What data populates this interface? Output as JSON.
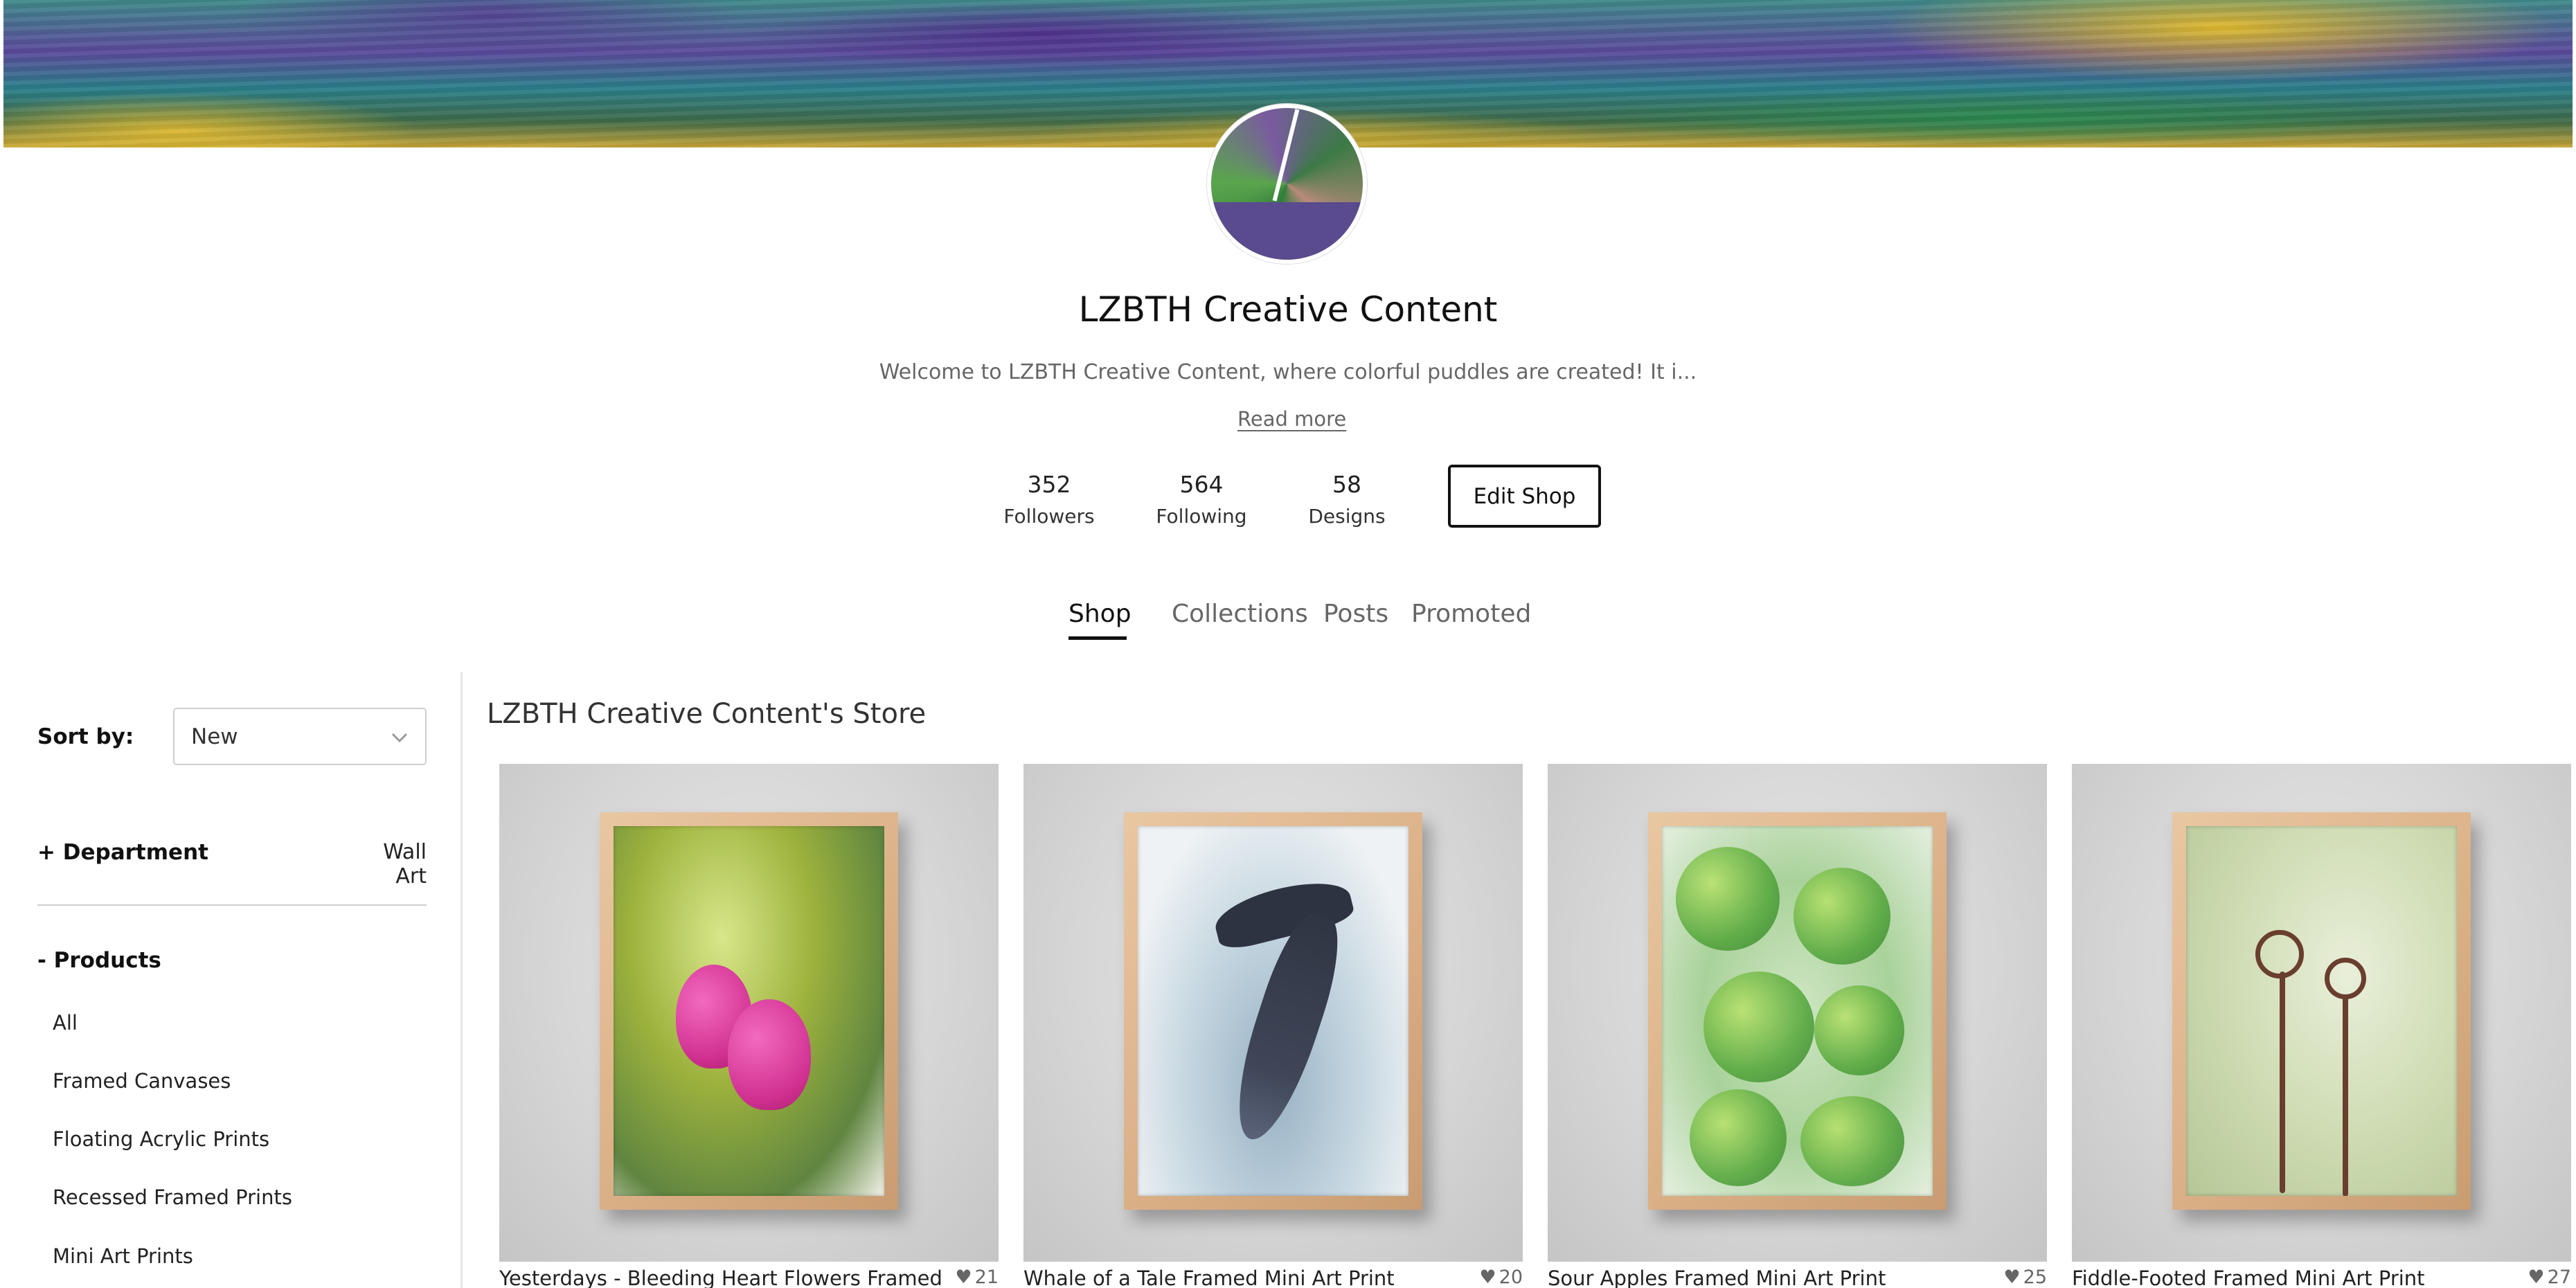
{
  "shop": {
    "name": "LZBTH Creative Content",
    "description": "Welcome to LZBTH Creative Content, where colorful puddles are created! It i...",
    "read_more": "Read more",
    "edit_button": "Edit Shop"
  },
  "stats": {
    "followers": {
      "value": "352",
      "label": "Followers"
    },
    "following": {
      "value": "564",
      "label": "Following"
    },
    "designs": {
      "value": "58",
      "label": "Designs"
    }
  },
  "tabs": [
    {
      "label": "Shop",
      "active": true
    },
    {
      "label": "Collections",
      "active": false
    },
    {
      "label": "Posts",
      "active": false
    },
    {
      "label": "Promoted",
      "active": false
    }
  ],
  "sidebar": {
    "sort_label": "Sort by:",
    "sort_value": "New",
    "department_label": "+ Department",
    "department_value": "Wall Art",
    "products_label": "- Products",
    "products": [
      "All",
      "Framed Canvases",
      "Floating Acrylic Prints",
      "Recessed Framed Prints",
      "Mini Art Prints"
    ]
  },
  "store_heading": "LZBTH Creative Content's Store",
  "cards": [
    {
      "title": "Yesterdays - Bleeding Heart Flowers Framed...",
      "likes": "21"
    },
    {
      "title": "Whale of a Tale Framed Mini Art Print",
      "likes": "20"
    },
    {
      "title": "Sour Apples Framed Mini Art Print",
      "likes": "25"
    },
    {
      "title": "Fiddle-Footed Framed Mini Art Print",
      "likes": "27"
    }
  ]
}
